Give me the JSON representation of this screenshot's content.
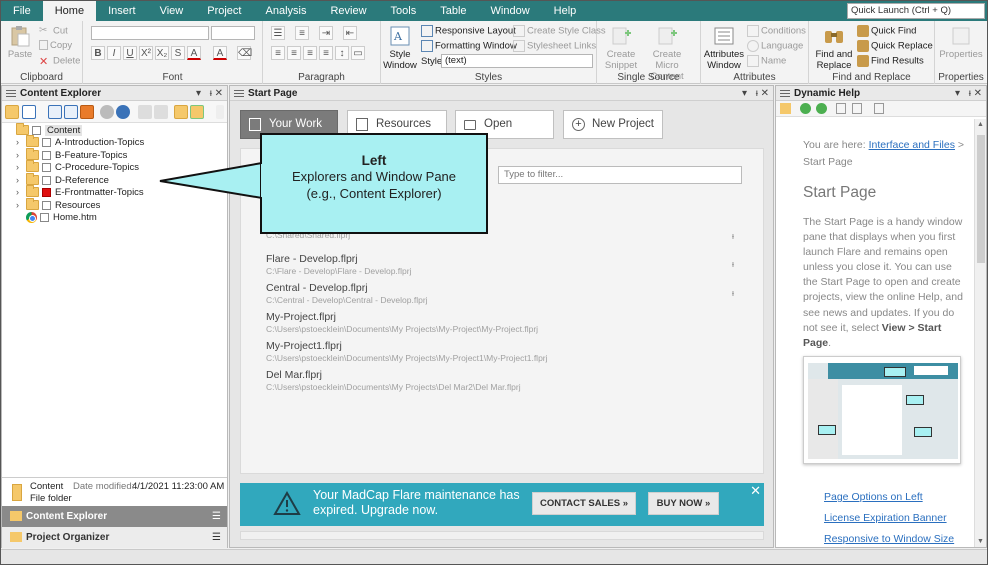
{
  "menu": {
    "items": [
      "File",
      "Home",
      "Insert",
      "View",
      "Project",
      "Analysis",
      "Review",
      "Tools",
      "Table",
      "Window",
      "Help"
    ],
    "active": "Home",
    "quick_launch": "Quick Launch (Ctrl + Q)"
  },
  "ribbon": {
    "clipboard": {
      "label": "Clipboard",
      "paste": "Paste",
      "cut": "Cut",
      "copy": "Copy",
      "delete": "Delete"
    },
    "font": {
      "label": "Font"
    },
    "paragraph": {
      "label": "Paragraph"
    },
    "styles": {
      "label": "Styles",
      "style_window": "Style Window",
      "responsive_layout": "Responsive Layout",
      "formatting_window": "Formatting Window",
      "create_style_class": "Create Style Class",
      "stylesheet_links": "Stylesheet Links",
      "style_label": "Style",
      "style_value": "(text)"
    },
    "single_source": {
      "label": "Single Source",
      "create_snippet": "Create Snippet",
      "create_micro_content": "Create Micro Content"
    },
    "attributes": {
      "label": "Attributes",
      "attributes_window": "Attributes Window",
      "conditions": "Conditions",
      "language": "Language",
      "name": "Name"
    },
    "find_replace": {
      "label": "Find and Replace",
      "find_replace": "Find and Replace",
      "quick_find": "Quick Find",
      "quick_replace": "Quick Replace",
      "find_results": "Find Results"
    },
    "properties": {
      "label": "Properties",
      "properties": "Properties"
    }
  },
  "content_explorer": {
    "title": "Content Explorer",
    "tree": [
      {
        "label": "Content",
        "type": "root"
      },
      {
        "label": "A-Introduction-Topics",
        "type": "folder"
      },
      {
        "label": "B-Feature-Topics",
        "type": "folder"
      },
      {
        "label": "C-Procedure-Topics",
        "type": "folder"
      },
      {
        "label": "D-Reference",
        "type": "folder"
      },
      {
        "label": "E-Frontmatter-Topics",
        "type": "folder",
        "marked": true
      },
      {
        "label": "Resources",
        "type": "folder"
      },
      {
        "label": "Home.htm",
        "type": "file"
      }
    ],
    "info": {
      "name": "Content",
      "date_label": "Date modified:",
      "date_value": "4/1/2021 11:23:00 AM",
      "kind": "File folder"
    },
    "tabs": [
      "Content Explorer",
      "Project Organizer"
    ]
  },
  "start_page": {
    "title": "Start Page",
    "buttons": [
      "Your Work",
      "Resources",
      "Open",
      "New Project"
    ],
    "filter_placeholder": "Type to filter...",
    "projects": [
      {
        "name": "",
        "path": "C:\\Shared\\Shared.flprj",
        "pinned": true
      },
      {
        "name": "Flare - Develop.flprj",
        "path": "C:\\Flare - Develop\\Flare - Develop.flprj",
        "pinned": true
      },
      {
        "name": "Central - Develop.flprj",
        "path": "C:\\Central - Develop\\Central - Develop.flprj",
        "pinned": true
      },
      {
        "name": "My-Project.flprj",
        "path": "C:\\Users\\pstoecklein\\Documents\\My Projects\\My-Project\\My-Project.flprj",
        "pinned": false
      },
      {
        "name": "My-Project1.flprj",
        "path": "C:\\Users\\pstoecklein\\Documents\\My Projects\\My-Project1\\My-Project1.flprj",
        "pinned": false
      },
      {
        "name": "Del Mar.flprj",
        "path": "C:\\Users\\pstoecklein\\Documents\\My Projects\\Del Mar2\\Del Mar.flprj",
        "pinned": false
      }
    ],
    "banner": {
      "message": "Your MadCap Flare maintenance has expired. Upgrade now.",
      "contact": "CONTACT SALES »",
      "buy": "BUY NOW »"
    }
  },
  "dynamic_help": {
    "title": "Dynamic Help",
    "you_are_here": "You are here:",
    "crumb_link": "Interface and Files",
    "crumb_tail": "> Start Page",
    "heading": "Start Page",
    "body_plain": "The Start Page is a handy window pane that displays when you first launch Flare and remains open unless you close it. You can use the Start Page to open and create projects, view the online Help, and see news and updates. If you do not see it, select",
    "body_bold": "View > Start Page",
    "body_end": ".",
    "links": [
      "Page Options on Left",
      "License Expiration Banner",
      "Responsive to Window Size"
    ]
  },
  "callout": {
    "title": "Left",
    "line1": "Explorers and Window Pane",
    "line2": "(e.g., Content Explorer)"
  },
  "colors": {
    "menu_bar": "#2b7a7b",
    "callout_fill": "#a8f0f2",
    "banner": "#31a8bd",
    "link": "#2a6fbf"
  }
}
